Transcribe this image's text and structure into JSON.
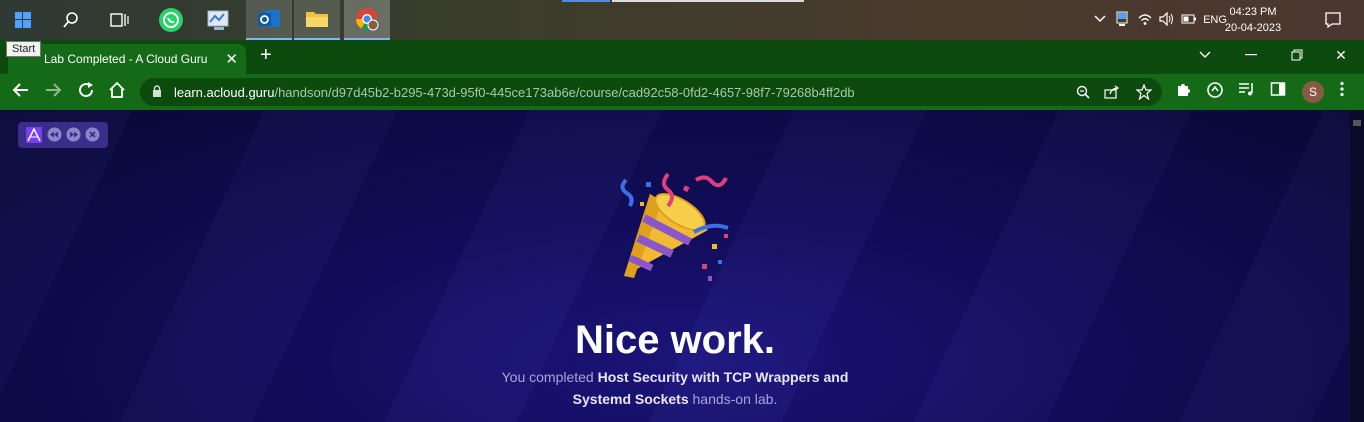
{
  "taskbar": {
    "start_tooltip": "Start",
    "clock_time": "04:23 PM",
    "clock_date": "20-04-2023",
    "language": "ENG"
  },
  "browser": {
    "tab_title": "Lab Completed - A Cloud Guru",
    "url_host": "learn.acloud.guru",
    "url_path": "/handson/d97d45b2-b295-473d-95f0-445ce173ab6e/course/cad92c58-0fd2-4657-98f7-79268b4ff2db",
    "profile_initial": "S"
  },
  "page": {
    "heading": "Nice work.",
    "message_prefix": "You completed ",
    "lab_name": "Host Security with TCP Wrappers and Systemd Sockets",
    "message_suffix": " hands-on lab."
  },
  "colors": {
    "browser_frame": "#156a17",
    "tabstrip": "#0d4a0d",
    "page_background": "#120d5e"
  }
}
